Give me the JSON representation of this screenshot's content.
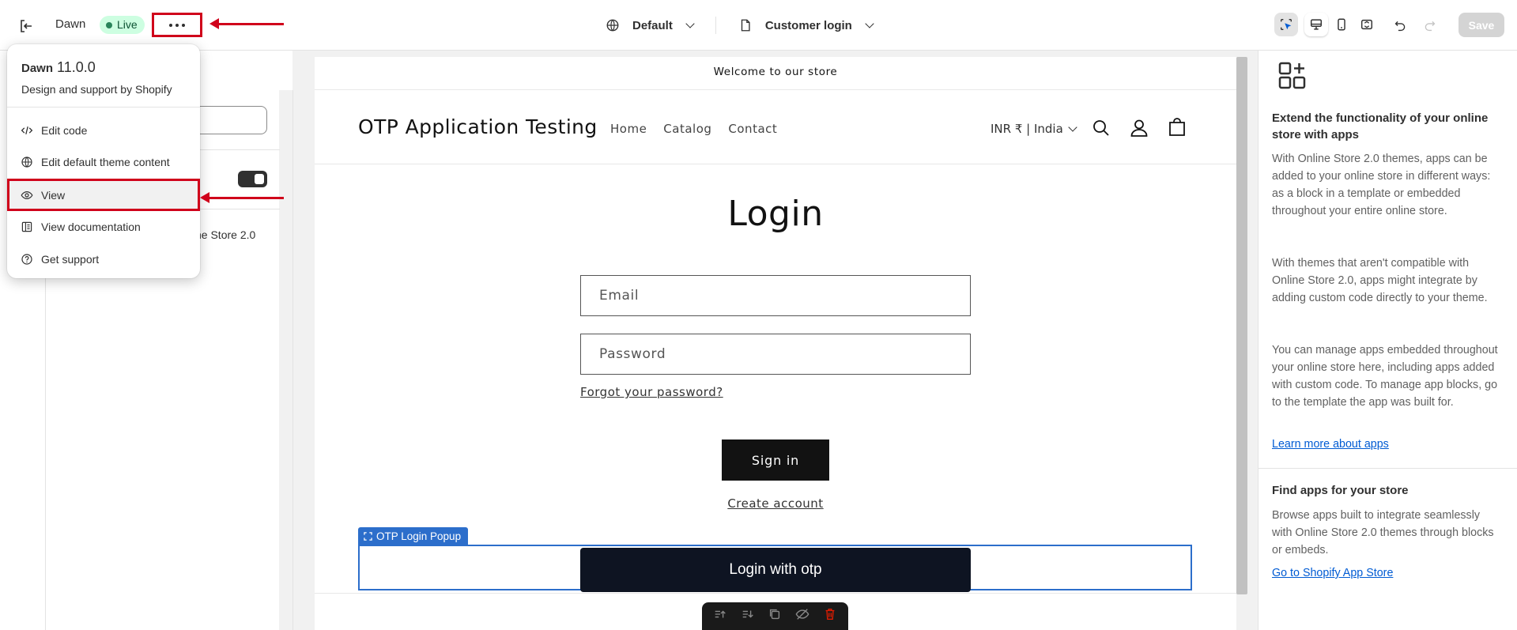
{
  "topbar": {
    "theme_name": "Dawn",
    "live_badge": "Live",
    "template_selector": "Default",
    "page_selector": "Customer login",
    "save_label": "Save"
  },
  "menu": {
    "theme_name": "Dawn",
    "version": "11.0.0",
    "subtitle": "Design and support by Shopify",
    "items": [
      {
        "label": "Edit code",
        "icon": "code-icon"
      },
      {
        "label": "Edit default theme content",
        "icon": "globe-icon"
      },
      {
        "label": "View",
        "icon": "eye-icon"
      },
      {
        "label": "View documentation",
        "icon": "book-icon"
      },
      {
        "label": "Get support",
        "icon": "question-icon"
      }
    ]
  },
  "sidebar": {
    "partial_text": "ne Store 2.0"
  },
  "preview": {
    "announcement": "Welcome to our store",
    "store_name": "OTP Application Testing",
    "nav": [
      "Home",
      "Catalog",
      "Contact"
    ],
    "currency": "INR ₹ | India",
    "login_title": "Login",
    "email_placeholder": "Email",
    "password_placeholder": "Password",
    "forgot_link": "Forgot your password?",
    "signin_label": "Sign in",
    "create_account": "Create account",
    "otp_block_label": "OTP Login Popup",
    "otp_button": "Login with otp"
  },
  "right_panel": {
    "heading1": "Extend the functionality of your online store with apps",
    "para1": "With Online Store 2.0 themes, apps can be added to your online store in different ways: as a block in a template or embedded throughout your entire online store.",
    "para2": "With themes that aren't compatible with Online Store 2.0, apps might integrate by adding custom code directly to your theme.",
    "para3": "You can manage apps embedded throughout your online store here, including apps added with custom code. To manage app blocks, go to the template the app was built for.",
    "link1": "Learn more about apps",
    "heading2": "Find apps for your store",
    "para4": "Browse apps built to integrate seamlessly with Online Store 2.0 themes through blocks or embeds.",
    "link2": "Go to Shopify App Store"
  },
  "colors": {
    "annotation_red": "#d0021b",
    "live_green": "#29845a",
    "selection_blue": "#2c6ecb",
    "link_blue": "#005bd3"
  }
}
